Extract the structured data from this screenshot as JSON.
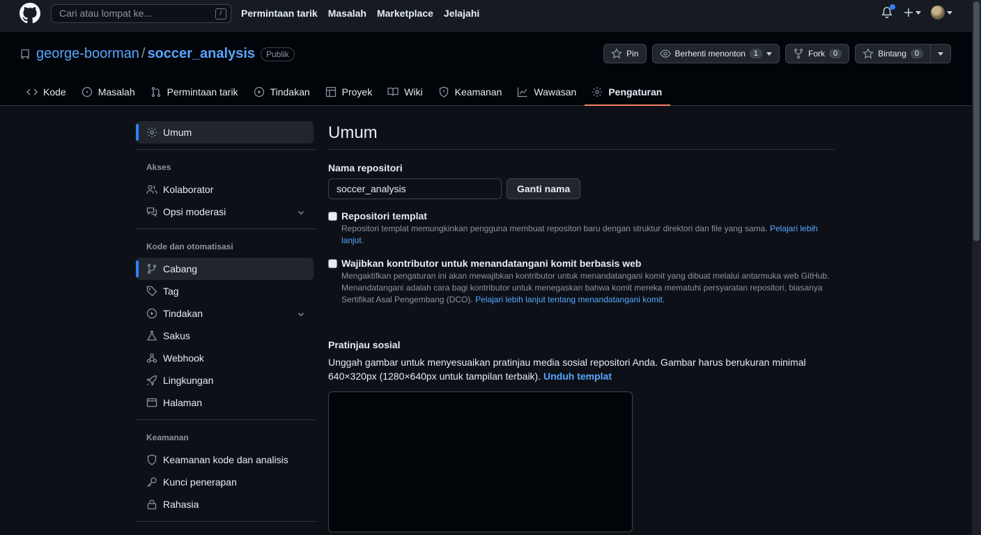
{
  "topbar": {
    "search_placeholder": "Cari atau lompat ke...",
    "search_shortcut": "/",
    "nav": [
      "Permintaan tarik",
      "Masalah",
      "Marketplace",
      "Jelajahi"
    ]
  },
  "repo": {
    "owner": "george-boorman",
    "separator": "/",
    "name": "soccer_analysis",
    "visibility": "Publik"
  },
  "actions": {
    "pin": "Pin",
    "watch": "Berhenti menonton",
    "watch_count": "1",
    "fork": "Fork",
    "fork_count": "0",
    "star": "Bintang",
    "star_count": "0"
  },
  "tabs": [
    "Kode",
    "Masalah",
    "Permintaan tarik",
    "Tindakan",
    "Proyek",
    "Wiki",
    "Keamanan",
    "Wawasan",
    "Pengaturan"
  ],
  "sidebar": {
    "general": "Umum",
    "access_heading": "Akses",
    "access": [
      "Kolaborator",
      "Opsi moderasi"
    ],
    "code_heading": "Kode dan otomatisasi",
    "code": [
      "Cabang",
      "Tag",
      "Tindakan",
      "Sakus",
      "Webhook",
      "Lingkungan",
      "Halaman"
    ],
    "security_heading": "Keamanan",
    "security": [
      "Keamanan kode dan analisis",
      "Kunci penerapan",
      "Rahasia"
    ]
  },
  "main": {
    "title": "Umum",
    "repo_name_label": "Nama repositori",
    "repo_name_value": "soccer_analysis",
    "rename_button": "Ganti nama",
    "template_title": "Repositori templat",
    "template_desc": "Repositori templat memungkinkan pengguna membuat repositori baru dengan struktur direktori dan file yang sama. ",
    "template_link": "Pelajari lebih lanjut.",
    "signoff_title": "Wajibkan kontributor untuk menandatangani komit berbasis web",
    "signoff_desc": "Mengaktifkan pengaturan ini akan mewajibkan kontributor untuk menandatangani komit yang dibuat melalui antarmuka web GitHub. Menandatangani adalah cara bagi kontributor untuk menegaskan bahwa komit mereka mematuhi persyaratan repositori, biasanya Sertifikat Asal Pengembang (DCO). ",
    "signoff_link": "Pelajari lebih lanjut tentang menandatangani komit.",
    "social_title": "Pratinjau sosial",
    "social_desc": "Unggah gambar untuk menyesuaikan pratinjau media sosial repositori Anda. Gambar harus berukuran minimal 640×320px (1280×640px untuk tampilan terbaik). ",
    "social_link": "Unduh templat"
  }
}
